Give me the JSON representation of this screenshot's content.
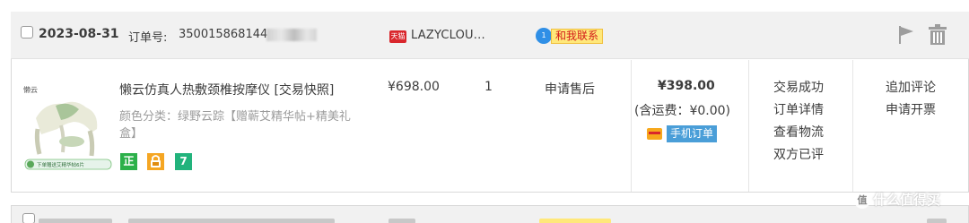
{
  "order": {
    "date": "2023-08-31",
    "order_no_label": "订单号:",
    "order_no_visible": "350015868144",
    "shop_badge": "天猫",
    "shop_name": "LAZYCLOU...",
    "contact_bubble": "1",
    "contact_label": "和我联系",
    "icons": {
      "flag": "flag-icon",
      "delete": "trash-icon"
    }
  },
  "item": {
    "thumb_brand": "懒云",
    "thumb_caption": "下单赠送艾精华帖6片",
    "title": "懒云仿真人热敷颈椎按摩仪",
    "snapshot_link": "[交易快照]",
    "variant_text": "颜色分类：绿野云踪【赠蕲艾精华帖+精美礼盒】",
    "badges": [
      {
        "label": "正",
        "color": "#2cb04a"
      },
      {
        "label": "",
        "color": "#f5a623"
      },
      {
        "label": "7",
        "color": "#22b37c"
      }
    ],
    "unit_price": "¥698.00",
    "quantity": "1",
    "after_sale_link": "申请售后"
  },
  "payment": {
    "total": "¥398.00",
    "shipping_note": "(含运费：¥0.00)",
    "mobile_order": "手机订单"
  },
  "status": {
    "links": [
      "交易成功",
      "订单详情",
      "查看物流",
      "双方已评"
    ]
  },
  "operations": {
    "links": [
      "追加评论",
      "申请开票"
    ]
  },
  "watermark": {
    "circle": "值",
    "text": "什么值得买"
  },
  "colors": {
    "header_bg": "#f1f1f1",
    "border": "#d9d9d9",
    "contact_bg": "#ffe87a",
    "contact_text": "#d31818",
    "mobile_bg": "#4a9ed8"
  }
}
